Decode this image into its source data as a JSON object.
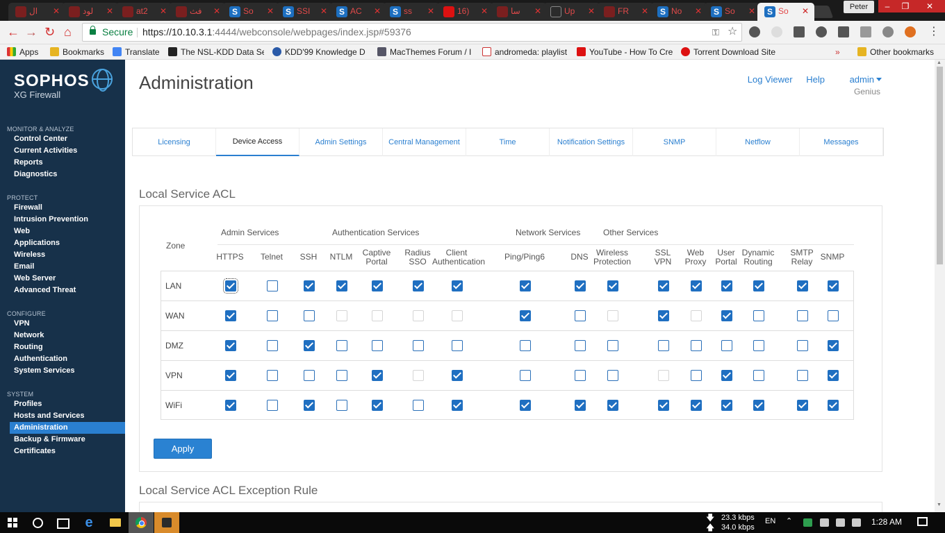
{
  "browser": {
    "tabs": [
      {
        "title": "ال",
        "icon": "red-swirl-icon"
      },
      {
        "title": "لود",
        "icon": "red-swirl-icon"
      },
      {
        "title": "at2",
        "icon": "red-swirl-icon"
      },
      {
        "title": "فث",
        "icon": "red-swirl-icon"
      },
      {
        "title": "So",
        "icon": "sophos-s-icon"
      },
      {
        "title": "SSI",
        "icon": "sophos-s-icon"
      },
      {
        "title": "AC",
        "icon": "sophos-s-icon"
      },
      {
        "title": "ss",
        "icon": "sophos-s-icon"
      },
      {
        "title": "16)",
        "icon": "youtube-icon"
      },
      {
        "title": "سا",
        "icon": "image-icon"
      },
      {
        "title": "Up",
        "icon": "document-icon"
      },
      {
        "title": "FR",
        "icon": "tv-icon"
      },
      {
        "title": "No",
        "icon": "sophos-s-icon"
      },
      {
        "title": "So",
        "icon": "sophos-s-icon"
      },
      {
        "title": "So",
        "icon": "sophos-s-icon",
        "active": true
      }
    ],
    "profile_name": "Peter",
    "security_label": "Secure",
    "url_host": "https://10.10.3.1",
    "url_rest": ":4444/webconsole/webpages/index.jsp#59376",
    "bookmarks": {
      "apps_label": "Apps",
      "items": [
        "Bookmarks",
        "Translate",
        "The NSL-KDD Data Se",
        "KDD'99 Knowledge D",
        "MacThemes Forum / I",
        "andromeda: playlist",
        "YouTube - How To Cre",
        "Torrent Download Site"
      ],
      "overflow": "»",
      "other_label": "Other bookmarks"
    }
  },
  "sidebar": {
    "logo": "SOPHOS",
    "product": "XG Firewall",
    "sections": [
      {
        "heading": "MONITOR & ANALYZE",
        "items": [
          "Control Center",
          "Current Activities",
          "Reports",
          "Diagnostics"
        ]
      },
      {
        "heading": "PROTECT",
        "items": [
          "Firewall",
          "Intrusion Prevention",
          "Web",
          "Applications",
          "Wireless",
          "Email",
          "Web Server",
          "Advanced Threat"
        ]
      },
      {
        "heading": "CONFIGURE",
        "items": [
          "VPN",
          "Network",
          "Routing",
          "Authentication",
          "System Services"
        ]
      },
      {
        "heading": "SYSTEM",
        "items": [
          "Profiles",
          "Hosts and Services",
          "Administration",
          "Backup & Firmware",
          "Certificates"
        ]
      }
    ],
    "active_item": "Administration"
  },
  "header": {
    "title": "Administration",
    "log_viewer": "Log Viewer",
    "help": "Help",
    "user": "admin",
    "role": "Genius"
  },
  "page_tabs": [
    "Licensing",
    "Device Access",
    "Admin Settings",
    "Central Management",
    "Time",
    "Notification Settings",
    "SNMP",
    "Netflow",
    "Messages"
  ],
  "active_tab": "Device Access",
  "acl": {
    "section_title": "Local Service ACL",
    "zone_header": "Zone",
    "groups": [
      "Admin Services",
      "Authentication Services",
      "Network Services",
      "Other Services"
    ],
    "columns": [
      {
        "label": "HTTPS"
      },
      {
        "label": "Telnet"
      },
      {
        "label": "SSH"
      },
      {
        "label": "NTLM"
      },
      {
        "label": "Captive Portal"
      },
      {
        "label": "Radius SSO"
      },
      {
        "label": "Client Authentication"
      },
      {
        "label": "Ping/Ping6"
      },
      {
        "label": "DNS"
      },
      {
        "label": "Wireless Protection"
      },
      {
        "label": "SSL VPN"
      },
      {
        "label": "Web Proxy"
      },
      {
        "label": "User Portal"
      },
      {
        "label": "Dynamic Routing"
      },
      {
        "label": "SMTP Relay"
      },
      {
        "label": "SNMP"
      }
    ],
    "rows": [
      {
        "zone": "LAN",
        "states": [
          "on",
          "off",
          "on",
          "on",
          "on",
          "on",
          "on",
          "on",
          "on",
          "on",
          "on",
          "on",
          "on",
          "on",
          "on",
          "on"
        ]
      },
      {
        "zone": "WAN",
        "states": [
          "on",
          "off",
          "off",
          "dis",
          "dis",
          "dis",
          "dis",
          "on",
          "off",
          "dis",
          "on",
          "dis",
          "on",
          "off",
          "off",
          "off"
        ]
      },
      {
        "zone": "DMZ",
        "states": [
          "on",
          "off",
          "on",
          "off",
          "off",
          "off",
          "off",
          "off",
          "off",
          "off",
          "off",
          "off",
          "off",
          "off",
          "off",
          "on"
        ]
      },
      {
        "zone": "VPN",
        "states": [
          "on",
          "off",
          "off",
          "off",
          "on",
          "dis",
          "on",
          "off",
          "off",
          "off",
          "dis",
          "off",
          "on",
          "off",
          "off",
          "on"
        ]
      },
      {
        "zone": "WiFi",
        "states": [
          "on",
          "off",
          "on",
          "off",
          "on",
          "off",
          "on",
          "on",
          "on",
          "on",
          "on",
          "on",
          "on",
          "on",
          "on",
          "on"
        ]
      }
    ],
    "apply_label": "Apply",
    "exception_title": "Local Service ACL Exception Rule"
  },
  "taskbar": {
    "download_speed": "23.3 kbps",
    "upload_speed": "34.0 kbps",
    "language": "EN",
    "time": "1:28 AM"
  }
}
